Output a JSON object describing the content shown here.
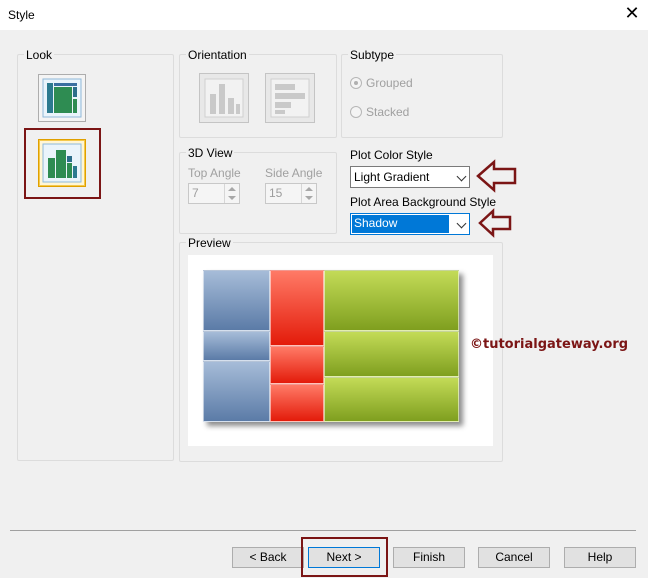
{
  "window": {
    "title": "Style"
  },
  "look": {
    "label": "Look"
  },
  "orientation": {
    "label": "Orientation"
  },
  "subtype": {
    "label": "Subtype",
    "options": [
      "Grouped",
      "Stacked"
    ],
    "selected": "Grouped"
  },
  "view3d": {
    "label": "3D View",
    "top_angle_label": "Top Angle",
    "top_angle_value": "7",
    "side_angle_label": "Side Angle",
    "side_angle_value": "15"
  },
  "plot_color_style": {
    "label": "Plot Color Style",
    "value": "Light Gradient"
  },
  "plot_area_bg_style": {
    "label": "Plot Area Background Style",
    "value": "Shadow"
  },
  "preview": {
    "label": "Preview"
  },
  "watermark": "©tutorialgateway.org",
  "buttons": {
    "back": "< Back",
    "next": "Next >",
    "finish": "Finish",
    "cancel": "Cancel",
    "help": "Help"
  },
  "colors": {
    "annotation": "#7b1515",
    "blue": "#6582ae",
    "red": "#ef2a16",
    "green": "#93b42b",
    "focus": "#0078d7"
  },
  "icons": [
    "close-icon",
    "treemap-squarified-icon",
    "treemap-slice-icon",
    "vertical-orientation-icon",
    "horizontal-orientation-icon",
    "arrow-annotation-icon"
  ]
}
